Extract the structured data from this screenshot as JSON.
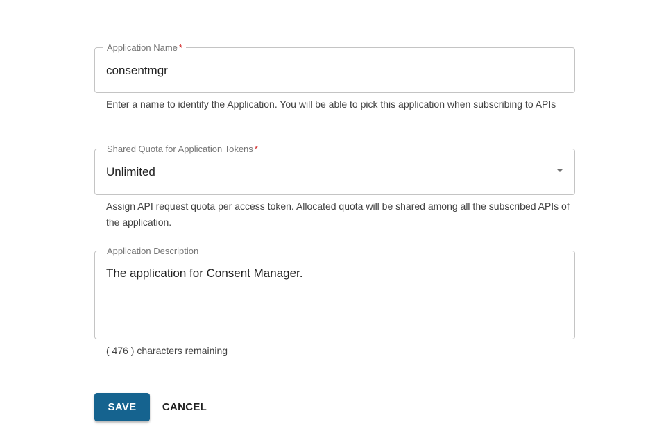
{
  "form": {
    "app_name": {
      "label": "Application Name",
      "required_mark": "*",
      "value": "consentmgr",
      "helper": "Enter a name to identify the Application. You will be able to pick this application when subscribing to APIs"
    },
    "quota": {
      "label": "Shared Quota for Application Tokens",
      "required_mark": "*",
      "value": "Unlimited",
      "dropdown_icon": "caret-down-icon",
      "helper": "Assign API request quota per access token. Allocated quota will be shared among all the subscribed APIs of the application."
    },
    "description": {
      "label": "Application Description",
      "value": "The application for Consent Manager.",
      "remaining": "( 476 ) characters remaining"
    }
  },
  "actions": {
    "save_label": "SAVE",
    "cancel_label": "CANCEL"
  },
  "colors": {
    "primary": "#15638f",
    "required": "#d32f2f",
    "border": "#c4c4c4",
    "label": "#757575"
  }
}
